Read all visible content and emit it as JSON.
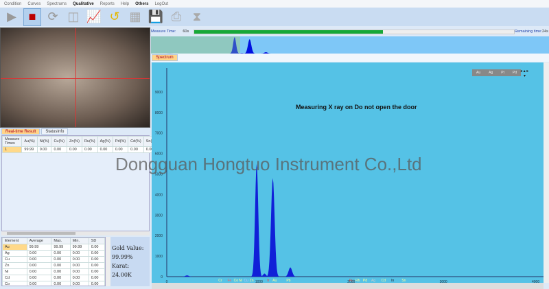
{
  "menu": [
    "Condition",
    "Curves",
    "Spectrums",
    "Qualitative",
    "Reports",
    "Help",
    "Others",
    "LogOut"
  ],
  "toolbar": [
    {
      "name": "play-icon",
      "g": "▶"
    },
    {
      "name": "stop-icon",
      "g": "■"
    },
    {
      "name": "refresh-icon",
      "g": "⟳"
    },
    {
      "name": "split-view-icon",
      "g": "◫"
    },
    {
      "name": "chart-line-icon",
      "g": "📈"
    },
    {
      "name": "history-icon",
      "g": "↺"
    },
    {
      "name": "calculator-icon",
      "g": "▦"
    },
    {
      "name": "save-icon",
      "g": "💾"
    },
    {
      "name": "print-icon",
      "g": "⎙"
    },
    {
      "name": "hourglass-icon",
      "g": "⧗"
    }
  ],
  "tabs": {
    "realtime": "Real-time Result",
    "status": "StatusInfo",
    "spectrum": "Spectrum"
  },
  "realtime": {
    "headers": [
      "Measure Times",
      "Au(%)",
      "Ni(%)",
      "Cu(%)",
      "Zn(%)",
      "Ru(%)",
      "Ag(%)",
      "Pd(%)",
      "Cd(%)",
      "Sn("
    ],
    "rows": [
      [
        "1",
        "99.99",
        "0.00",
        "0.00",
        "0.00",
        "0.00",
        "0.00",
        "0.00",
        "0.00",
        "0.00"
      ]
    ]
  },
  "stats": {
    "headers": [
      "Element",
      "Average",
      "Max.",
      "Min.",
      "SD"
    ],
    "rows": [
      [
        "Au",
        "99.99",
        "99.99",
        "99.99",
        "0.00"
      ],
      [
        "Ag",
        "0.00",
        "0.00",
        "0.00",
        "0.00"
      ],
      [
        "Cu",
        "0.00",
        "0.00",
        "0.00",
        "0.00"
      ],
      [
        "Zn",
        "0.00",
        "0.00",
        "0.00",
        "0.00"
      ],
      [
        "Ni",
        "0.00",
        "0.00",
        "0.00",
        "0.00"
      ],
      [
        "Cd",
        "0.00",
        "0.00",
        "0.00",
        "0.00"
      ],
      [
        "Co",
        "0.00",
        "0.00",
        "0.00",
        "0.00"
      ]
    ]
  },
  "gold": {
    "value_label": "Gold Value:",
    "value": "99.99%",
    "karat_label": "Karat:",
    "karat": "24.00K"
  },
  "measure": {
    "label": "Measure Time:",
    "time": "60s",
    "progress": 0.59,
    "remaining_label": "Remaining time:",
    "remaining": "24s"
  },
  "spectrum": {
    "warning": "Measuring   X ray on   Do not open the door",
    "element_buttons": [
      "Au",
      "Ag",
      "Pt",
      "Pd"
    ]
  },
  "watermark": "Dongguan Hongtuo Instrument Co.,Ltd",
  "chart_data": {
    "type": "area",
    "xlim": [
      0,
      4100
    ],
    "ylim": [
      0,
      9500
    ],
    "xticks": [
      0,
      1000,
      2000,
      3000,
      4000
    ],
    "yticks": [
      0,
      1000,
      2000,
      3000,
      4000,
      5000,
      6000,
      7000,
      8000,
      9000
    ],
    "peaks": [
      {
        "x": 220,
        "y": 60,
        "w": 25
      },
      {
        "x": 975,
        "y": 5500,
        "w": 22
      },
      {
        "x": 1150,
        "y": 4800,
        "w": 25
      },
      {
        "x": 1340,
        "y": 450,
        "w": 25
      },
      {
        "x": 1060,
        "y": 150,
        "w": 20
      }
    ],
    "element_markers": [
      {
        "el": "Cr",
        "x": 580
      },
      {
        "el": "Fe",
        "x": 680
      },
      {
        "el": "Co",
        "x": 750
      },
      {
        "el": "Ni",
        "x": 800
      },
      {
        "el": "Cu",
        "x": 860
      },
      {
        "el": "Zn",
        "x": 920
      },
      {
        "el": "Ir",
        "x": 1100
      },
      {
        "el": "Au",
        "x": 1170
      },
      {
        "el": "Pb",
        "x": 1320
      },
      {
        "el": "Ru",
        "x": 2000
      },
      {
        "el": "Rh",
        "x": 2070
      },
      {
        "el": "Pd",
        "x": 2150
      },
      {
        "el": "Ag",
        "x": 2240
      },
      {
        "el": "Cd",
        "x": 2350
      },
      {
        "el": "In",
        "x": 2450
      },
      {
        "el": "Sn",
        "x": 2570
      }
    ]
  }
}
